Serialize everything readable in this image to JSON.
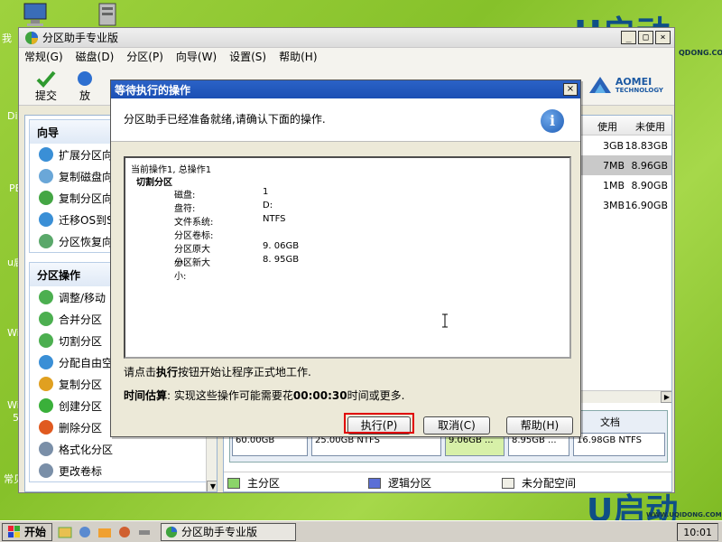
{
  "desktop": {
    "labels": [
      "我",
      "Dis",
      "PE",
      "u启",
      "Win",
      "Win",
      "5",
      "常见"
    ],
    "brand_top": "U启动",
    "brand_top_url": "QDONG.COM",
    "brand_bottom": "U启动",
    "brand_bottom_url": "WWW.UQIDONG.COM"
  },
  "main_window": {
    "title": "分区助手专业版",
    "window_buttons": [
      "_",
      "□",
      "×"
    ],
    "menu": [
      "常规(G)",
      "磁盘(D)",
      "分区(P)",
      "向导(W)",
      "设置(S)",
      "帮助(H)"
    ],
    "toolbar": [
      "提交",
      "放"
    ],
    "logo_name": "AOMEI",
    "logo_sub": "TECHNOLOGY",
    "left": {
      "wizard_title": "向导",
      "wizard_items": [
        "扩展分区向",
        "复制磁盘向",
        "复制分区向",
        "迁移OS到S",
        "分区恢复向"
      ],
      "ops_title": "分区操作",
      "ops_items": [
        "调整/移动",
        "合并分区",
        "切割分区",
        "分配自由空",
        "复制分区",
        "创建分区",
        "删除分区",
        "格式化分区",
        "更改卷标"
      ]
    },
    "right": {
      "columns": [
        "使用",
        "未使用"
      ],
      "rows": [
        {
          "used": "3GB",
          "free": "18.83GB"
        },
        {
          "used": "7MB",
          "free": "8.96GB"
        },
        {
          "used": "1MB",
          "free": "8.90GB"
        },
        {
          "used": "3MB",
          "free": "16.90GB"
        }
      ],
      "disk_segments": [
        {
          "label": "60.00GB",
          "color": "#c6d9f0"
        },
        {
          "label": "25.00GB NTFS",
          "color": "#c6d9f0"
        },
        {
          "label": "9.06GB ...",
          "color": "#d7f0a8"
        },
        {
          "label": "8.95GB ...",
          "color": "#c6d9f0"
        },
        {
          "label": "16.98GB NTFS",
          "color": "#c6d9f0"
        }
      ],
      "disk_header_tail": "文档",
      "legend": [
        {
          "label": "主分区",
          "color": "#8bd46a"
        },
        {
          "label": "逻辑分区",
          "color": "#5b6fd6"
        },
        {
          "label": "未分配空间",
          "color": "#f0efe6"
        }
      ]
    }
  },
  "dialog": {
    "title": "等待执行的操作",
    "close": "×",
    "header_text": "分区助手已经准备就绪,请确认下面的操作.",
    "info_glyph": "i",
    "op_status": "当前操作1, 总操作1",
    "op_name": "切割分区",
    "op_details": [
      {
        "key": "磁盘:",
        "value": "1"
      },
      {
        "key": "盘符:",
        "value": "D:"
      },
      {
        "key": "文件系统:",
        "value": "NTFS"
      },
      {
        "key": "分区卷标:",
        "value": ""
      },
      {
        "key": "分区原大小:",
        "value": "9. 06GB"
      },
      {
        "key": "分区新大小:",
        "value": "8. 95GB"
      }
    ],
    "msg_pre": "请点击",
    "msg_bold": "执行",
    "msg_post": "按钮开始让程序正式地工作.",
    "est_label": "时间估算",
    "est_pre": ": 实现这些操作可能需要花",
    "est_time": "00:00:30",
    "est_post": "时间或更多.",
    "buttons": {
      "execute": "执行(P)",
      "cancel": "取消(C)",
      "help": "帮助(H)"
    }
  },
  "taskbar": {
    "start": "开始",
    "task": "分区助手专业版",
    "clock": "10:01"
  },
  "colors": {
    "highlight": "#e00000",
    "dialog_title": "#1f55bd",
    "desktop": "#86c12a"
  }
}
